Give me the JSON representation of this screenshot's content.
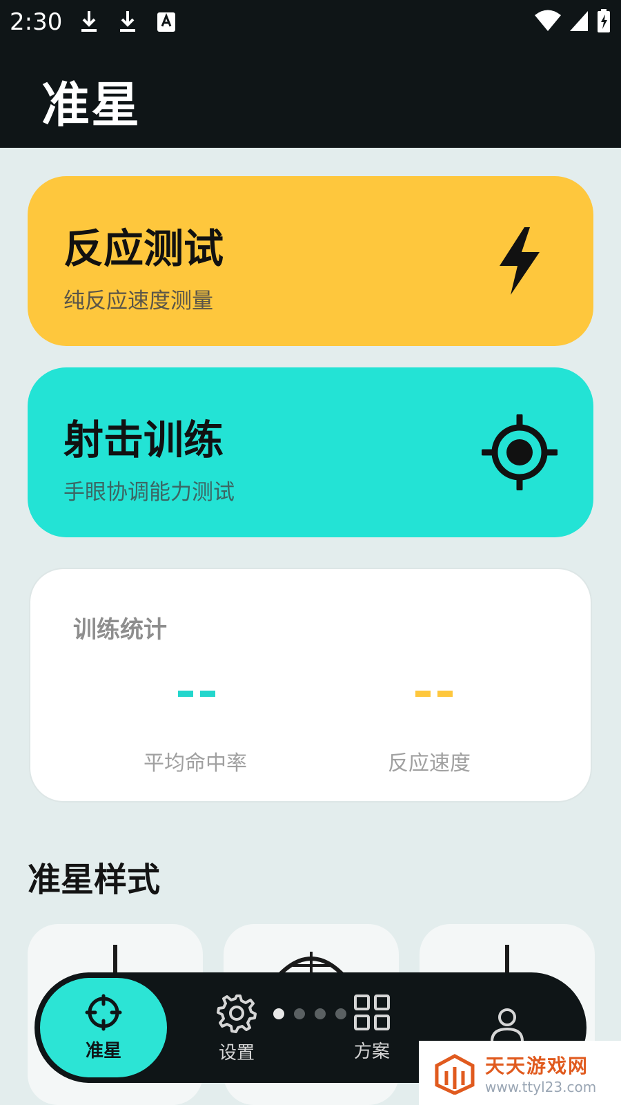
{
  "status_bar": {
    "time": "2:30"
  },
  "app": {
    "title": "准星"
  },
  "cards": [
    {
      "title": "反应测试",
      "subtitle": "纯反应速度测量",
      "icon": "lightning-icon",
      "color": "#fec73d"
    },
    {
      "title": "射击训练",
      "subtitle": "手眼协调能力测试",
      "icon": "crosshair-target-icon",
      "color": "#23e3d5"
    }
  ],
  "stats": {
    "title": "训练统计",
    "items": [
      {
        "value": "--",
        "label": "平均命中率",
        "color": "#23d6cc"
      },
      {
        "value": "--",
        "label": "反应速度",
        "color": "#fec73d"
      }
    ]
  },
  "crosshair_styles": {
    "title": "准星样式"
  },
  "bottom_nav": {
    "items": [
      {
        "label": "准星",
        "icon": "crosshair-icon",
        "active": true
      },
      {
        "label": "设置",
        "icon": "gear-icon",
        "active": false
      },
      {
        "label": "方案",
        "icon": "grid-icon",
        "active": false
      },
      {
        "label": "",
        "icon": "user-icon",
        "active": false
      }
    ],
    "page_dots": 4,
    "active_dot": 1
  },
  "watermark": {
    "title": "天天游戏网",
    "url": "www.ttyl23.com"
  }
}
